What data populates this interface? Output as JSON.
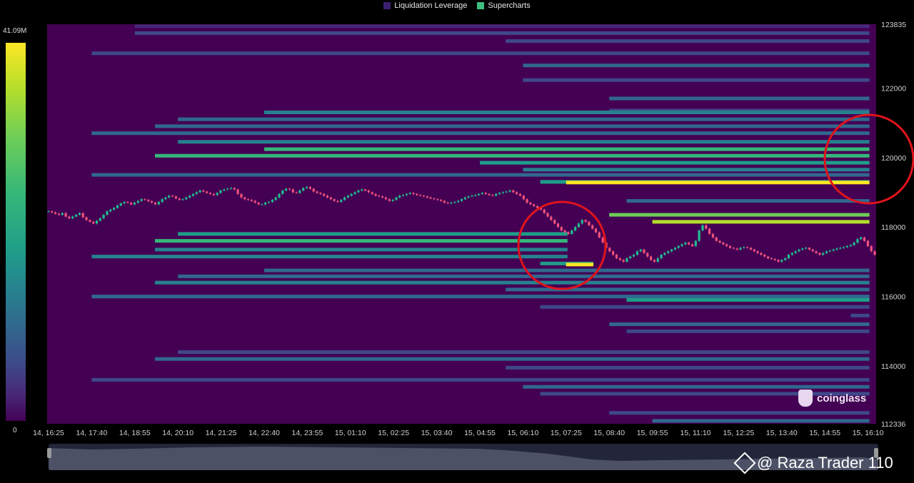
{
  "legend": {
    "items": [
      {
        "label": "Liquidation Leverage",
        "color": "#3b1f6e"
      },
      {
        "label": "Supercharts",
        "color": "#3fbf7f"
      }
    ]
  },
  "colorbar": {
    "max_label": "41.09M",
    "min_label": "0"
  },
  "brand": {
    "text": "coinglass"
  },
  "watermark": {
    "text": "@ Raza Trader 110"
  },
  "chart_data": {
    "type": "heatmap",
    "title": "",
    "x_tick_labels": [
      "14, 16:25",
      "14, 17:40",
      "14, 18:55",
      "14, 20:10",
      "14, 21:25",
      "14, 22:40",
      "14, 23:55",
      "15, 01:10",
      "15, 02:25",
      "15, 03:40",
      "15, 04:55",
      "15, 06:10",
      "15, 07:25",
      "15, 08:40",
      "15, 09:55",
      "15, 11:10",
      "15, 12:25",
      "15, 13:40",
      "15, 14:55",
      "15, 16:10"
    ],
    "y_tick_labels": [
      "123835",
      "122000",
      "120000",
      "118000",
      "116000",
      "114000",
      "112336"
    ],
    "ylim": [
      112336,
      123835
    ],
    "colorscale": [
      "#440154",
      "#482878",
      "#3e4989",
      "#31688e",
      "#26828e",
      "#1f9e89",
      "#35b779",
      "#6ece58",
      "#b5de2b",
      "#fde725"
    ],
    "value_max": 41090000,
    "bands": [
      {
        "price": 123780,
        "x_start": "14, 18:55",
        "x_end": "15, 16:10",
        "level": 0.12
      },
      {
        "price": 123580,
        "x_start": "14, 18:55",
        "x_end": "15, 16:10",
        "level": 0.18
      },
      {
        "price": 123350,
        "x_start": "15, 05:40",
        "x_end": "15, 16:10",
        "level": 0.25
      },
      {
        "price": 123000,
        "x_start": "14, 17:40",
        "x_end": "15, 16:10",
        "level": 0.18
      },
      {
        "price": 122650,
        "x_start": "15, 06:10",
        "x_end": "15, 16:10",
        "level": 0.3
      },
      {
        "price": 122230,
        "x_start": "15, 06:10",
        "x_end": "15, 16:10",
        "level": 0.22
      },
      {
        "price": 121700,
        "x_start": "15, 08:40",
        "x_end": "15, 16:10",
        "level": 0.28
      },
      {
        "price": 121350,
        "x_start": "15, 08:40",
        "x_end": "15, 16:10",
        "level": 0.22
      },
      {
        "price": 121300,
        "x_start": "14, 22:40",
        "x_end": "15, 16:10",
        "level": 0.42
      },
      {
        "price": 121100,
        "x_start": "14, 20:10",
        "x_end": "15, 16:10",
        "level": 0.35
      },
      {
        "price": 120900,
        "x_start": "14, 19:30",
        "x_end": "15, 16:10",
        "level": 0.3
      },
      {
        "price": 120700,
        "x_start": "14, 17:40",
        "x_end": "15, 16:10",
        "level": 0.3
      },
      {
        "price": 120450,
        "x_start": "14, 20:10",
        "x_end": "15, 16:10",
        "level": 0.45
      },
      {
        "price": 120240,
        "x_start": "14, 22:40",
        "x_end": "15, 16:10",
        "level": 0.65
      },
      {
        "price": 120050,
        "x_start": "14, 19:30",
        "x_end": "15, 16:10",
        "level": 0.7
      },
      {
        "price": 119850,
        "x_start": "15, 04:55",
        "x_end": "15, 16:10",
        "level": 0.55
      },
      {
        "price": 119650,
        "x_start": "15, 06:10",
        "x_end": "15, 16:10",
        "level": 0.45
      },
      {
        "price": 119500,
        "x_start": "14, 17:40",
        "x_end": "15, 16:10",
        "level": 0.35
      },
      {
        "price": 119300,
        "x_start": "15, 06:40",
        "x_end": "15, 16:10",
        "level": 0.5
      },
      {
        "price": 119280,
        "x_start": "15, 07:25",
        "x_end": "15, 16:10",
        "level": 1.0
      },
      {
        "price": 118750,
        "x_start": "15, 09:10",
        "x_end": "15, 16:10",
        "level": 0.28
      },
      {
        "price": 118350,
        "x_start": "15, 08:40",
        "x_end": "15, 16:10",
        "level": 0.8
      },
      {
        "price": 118150,
        "x_start": "15, 09:55",
        "x_end": "15, 16:10",
        "level": 0.9
      },
      {
        "price": 117800,
        "x_start": "14, 20:10",
        "x_end": "15, 07:25",
        "level": 0.6
      },
      {
        "price": 117600,
        "x_start": "14, 19:30",
        "x_end": "15, 07:25",
        "level": 0.65
      },
      {
        "price": 117350,
        "x_start": "14, 19:30",
        "x_end": "15, 07:25",
        "level": 0.45
      },
      {
        "price": 117150,
        "x_start": "14, 17:40",
        "x_end": "15, 07:25",
        "level": 0.4
      },
      {
        "price": 116950,
        "x_start": "15, 06:40",
        "x_end": "15, 08:10",
        "level": 0.5
      },
      {
        "price": 116920,
        "x_start": "15, 07:25",
        "x_end": "15, 08:10",
        "level": 1.0
      },
      {
        "price": 116750,
        "x_start": "14, 22:40",
        "x_end": "15, 16:10",
        "level": 0.35
      },
      {
        "price": 116580,
        "x_start": "14, 20:10",
        "x_end": "15, 16:10",
        "level": 0.38
      },
      {
        "price": 116400,
        "x_start": "14, 19:30",
        "x_end": "15, 16:10",
        "level": 0.42
      },
      {
        "price": 116200,
        "x_start": "15, 05:40",
        "x_end": "15, 16:10",
        "level": 0.32
      },
      {
        "price": 116000,
        "x_start": "14, 17:40",
        "x_end": "15, 16:10",
        "level": 0.3
      },
      {
        "price": 115900,
        "x_start": "15, 09:10",
        "x_end": "15, 16:10",
        "level": 0.6
      },
      {
        "price": 115700,
        "x_start": "15, 06:40",
        "x_end": "15, 16:10",
        "level": 0.25
      },
      {
        "price": 115450,
        "x_start": "15, 15:40",
        "x_end": "15, 16:10",
        "level": 0.2
      },
      {
        "price": 115200,
        "x_start": "15, 08:40",
        "x_end": "15, 16:10",
        "level": 0.3
      },
      {
        "price": 115000,
        "x_start": "15, 09:10",
        "x_end": "15, 16:10",
        "level": 0.25
      },
      {
        "price": 114400,
        "x_start": "14, 20:10",
        "x_end": "15, 16:10",
        "level": 0.25
      },
      {
        "price": 114200,
        "x_start": "14, 19:30",
        "x_end": "15, 16:10",
        "level": 0.3
      },
      {
        "price": 113950,
        "x_start": "15, 05:40",
        "x_end": "15, 16:10",
        "level": 0.2
      },
      {
        "price": 113600,
        "x_start": "14, 17:40",
        "x_end": "15, 16:10",
        "level": 0.18
      },
      {
        "price": 113400,
        "x_start": "15, 06:10",
        "x_end": "15, 16:10",
        "level": 0.32
      },
      {
        "price": 113200,
        "x_start": "15, 06:40",
        "x_end": "15, 16:10",
        "level": 0.22
      },
      {
        "price": 112650,
        "x_start": "15, 08:40",
        "x_end": "15, 16:10",
        "level": 0.25
      },
      {
        "price": 112420,
        "x_start": "15, 09:55",
        "x_end": "15, 16:10",
        "level": 0.3
      }
    ],
    "price_series": {
      "type": "candlestick",
      "close": [
        118450,
        118420,
        118380,
        118350,
        118400,
        118300,
        118250,
        118300,
        118350,
        118400,
        118280,
        118200,
        118150,
        118100,
        118180,
        118250,
        118350,
        118450,
        118500,
        118550,
        118620,
        118680,
        118720,
        118700,
        118650,
        118700,
        118750,
        118800,
        118780,
        118740,
        118700,
        118650,
        118720,
        118800,
        118850,
        118900,
        118880,
        118820,
        118780,
        118800,
        118850,
        118900,
        118950,
        119000,
        119050,
        119020,
        118980,
        118950,
        118920,
        118980,
        119050,
        119080,
        119100,
        119120,
        119080,
        118950,
        118850,
        118800,
        118780,
        118750,
        118700,
        118650,
        118650,
        118700,
        118720,
        118780,
        118850,
        118950,
        119050,
        119100,
        119080,
        119000,
        118980,
        119050,
        119120,
        119150,
        119100,
        119020,
        118980,
        118950,
        118900,
        118850,
        118800,
        118750,
        118720,
        118780,
        118850,
        118900,
        118950,
        119000,
        119050,
        119080,
        119050,
        119000,
        118950,
        118900,
        118880,
        118850,
        118800,
        118750,
        118780,
        118850,
        118900,
        118920,
        118950,
        118980,
        118950,
        118920,
        118900,
        118880,
        118850,
        118820,
        118800,
        118780,
        118750,
        118700,
        118680,
        118700,
        118720,
        118750,
        118800,
        118850,
        118880,
        118900,
        118920,
        118950,
        118980,
        118950,
        118920,
        118900,
        118950,
        118980,
        119000,
        119020,
        119050,
        119000,
        118950,
        118900,
        118800,
        118700,
        118650,
        118600,
        118550,
        118500,
        118400,
        118300,
        118200,
        118100,
        118000,
        117900,
        117850,
        117800,
        117900,
        118000,
        118100,
        118200,
        118150,
        118050,
        117950,
        117850,
        117700,
        117550,
        117400,
        117300,
        117200,
        117100,
        117050,
        117000,
        117100,
        117150,
        117200,
        117300,
        117350,
        117250,
        117150,
        117050,
        117000,
        117100,
        117200,
        117250,
        117300,
        117350,
        117400,
        117450,
        117500,
        117550,
        117500,
        117450,
        117600,
        117900,
        118050,
        117950,
        117800,
        117700,
        117600,
        117550,
        117500,
        117450,
        117400,
        117380,
        117350,
        117400,
        117420,
        117400,
        117350,
        117300,
        117250,
        117200,
        117150,
        117100,
        117080,
        117050,
        117000,
        117050,
        117100,
        117200,
        117250,
        117300,
        117350,
        117380,
        117400,
        117350,
        117300,
        117250,
        117200,
        117250,
        117300,
        117320,
        117350,
        117380,
        117400,
        117420,
        117450,
        117480,
        117550,
        117650,
        117700,
        117600,
        117450,
        117300,
        117200
      ]
    }
  }
}
